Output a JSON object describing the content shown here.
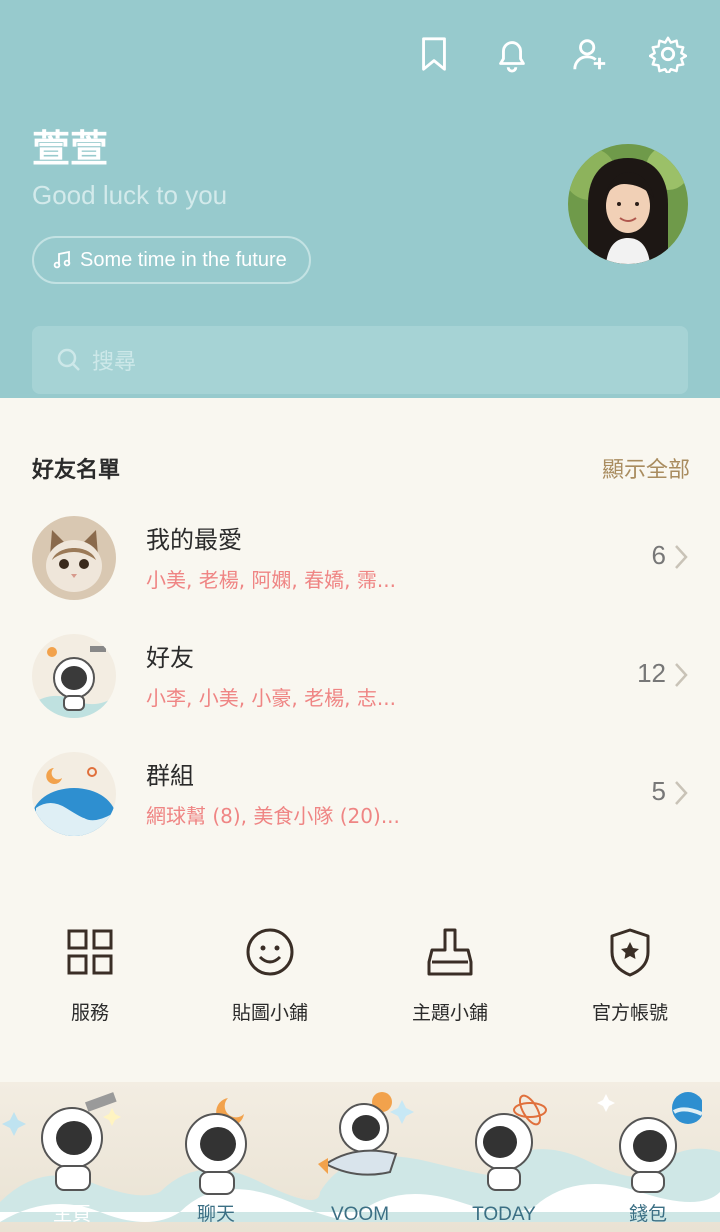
{
  "profile": {
    "name": "萱萱",
    "status": "Good luck to you",
    "music": "Some time in the future"
  },
  "search": {
    "placeholder": "搜尋"
  },
  "friends": {
    "title": "好友名單",
    "show_all": "顯示全部",
    "groups": [
      {
        "title": "我的最愛",
        "members": "小美, 老楊, 阿嫻, 春嬌, 霈...",
        "count": "6"
      },
      {
        "title": "好友",
        "members": "小李, 小美, 小豪, 老楊, 志...",
        "count": "12"
      },
      {
        "title": "群組",
        "members": "網球幫 (8), 美食小隊 (20)...",
        "count": "5"
      }
    ]
  },
  "services": [
    {
      "label": "服務",
      "icon": "grid-icon"
    },
    {
      "label": "貼圖小鋪",
      "icon": "smiley-icon"
    },
    {
      "label": "主題小鋪",
      "icon": "brush-icon"
    },
    {
      "label": "官方帳號",
      "icon": "shield-star-icon"
    }
  ],
  "tabs": [
    {
      "label": "主頁",
      "active": true
    },
    {
      "label": "聊天"
    },
    {
      "label": "VOOM"
    },
    {
      "label": "TODAY"
    },
    {
      "label": "錢包"
    }
  ],
  "colors": {
    "header": "#97cacd",
    "accent_link": "#a98c5f",
    "member_text": "#ef8584",
    "background": "#f9f7f0"
  }
}
